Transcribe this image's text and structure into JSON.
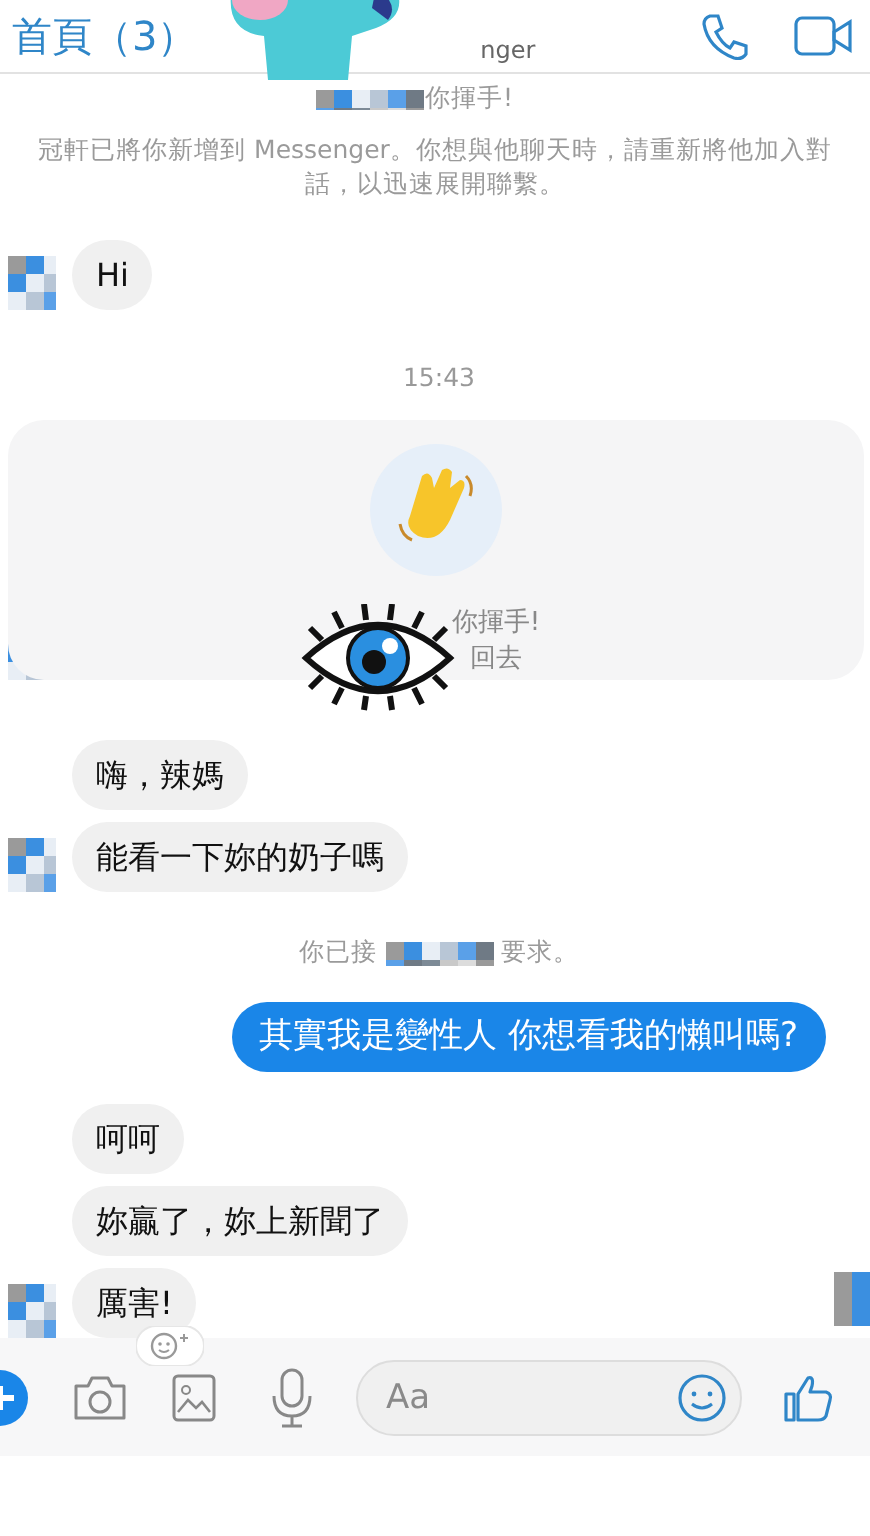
{
  "header": {
    "back_label": "首頁（3）",
    "subtitle": "nger"
  },
  "notice": {
    "wave_line": "你揮手!",
    "text": "冠軒已將你新增到 Messenger。你想與他聊天時，請重新將他加入對話，以迅速展開聯繫。"
  },
  "messages": [
    {
      "kind": "received",
      "text": "Hi",
      "avatar": true,
      "reaction": false
    },
    {
      "kind": "time",
      "text": "15:43"
    },
    {
      "kind": "wave",
      "lines": [
        "你揮手!",
        "回去"
      ],
      "avatar": true
    },
    {
      "kind": "received",
      "text": "嗨，辣媽",
      "avatar": false,
      "reaction": false
    },
    {
      "kind": "received",
      "text": "能看一下妳的奶子嗎",
      "avatar": true,
      "reaction": false
    },
    {
      "kind": "system",
      "parts": [
        "你已接",
        "要求。"
      ]
    },
    {
      "kind": "sent",
      "text": "其實我是變性人  你想看我的懶叫嗎?"
    },
    {
      "kind": "received",
      "text": "呵呵",
      "avatar": false,
      "reaction": false
    },
    {
      "kind": "received",
      "text": "妳贏了，妳上新聞了",
      "avatar": false,
      "reaction": false
    },
    {
      "kind": "received",
      "text": "厲害!",
      "avatar": true,
      "reaction": true
    }
  ],
  "composer": {
    "placeholder": "Aa"
  }
}
